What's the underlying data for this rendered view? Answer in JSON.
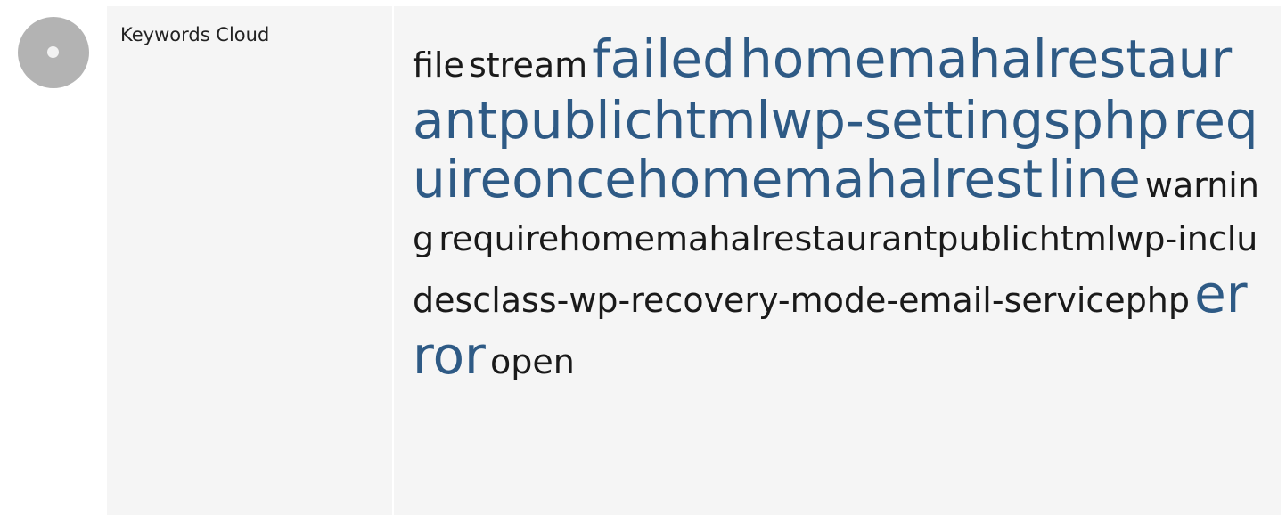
{
  "status": {
    "icon": "grey-circle-icon",
    "color": "#b3b3b3"
  },
  "label": "Keywords Cloud",
  "keywords": [
    {
      "text": "file",
      "weight": "small"
    },
    {
      "text": "stream",
      "weight": "small"
    },
    {
      "text": "failed",
      "weight": "large"
    },
    {
      "text": "homemahalrestaurantpublichtmlwp-settingsphp",
      "weight": "large"
    },
    {
      "text": "requireoncehomemahalrest",
      "weight": "large"
    },
    {
      "text": "line",
      "weight": "large"
    },
    {
      "text": "warning",
      "weight": "small"
    },
    {
      "text": "requirehomemahalrestaurantpublichtmlwp-includesclass-wp-recovery-mode-email-servicephp",
      "weight": "small"
    },
    {
      "text": "error",
      "weight": "large"
    },
    {
      "text": "open",
      "weight": "small"
    }
  ],
  "colors": {
    "large_keyword": "#2e5a85",
    "small_keyword": "#1a1a1a",
    "panel_bg": "#f5f5f5"
  }
}
